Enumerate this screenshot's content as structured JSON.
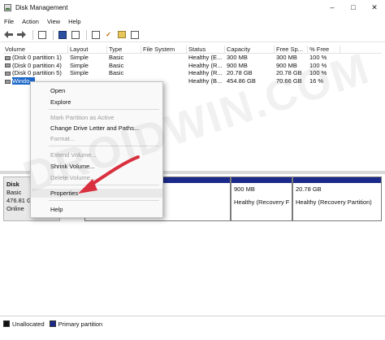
{
  "window": {
    "title": "Disk Management",
    "controls": [
      "–",
      "□",
      "✕"
    ]
  },
  "menu": [
    "File",
    "Action",
    "View",
    "Help"
  ],
  "toolbar_icons": [
    "back-arrow-icon",
    "forward-arrow-icon",
    "console-tree-icon",
    "help-icon",
    "properties-icon",
    "layout-icon",
    "check-icon",
    "folder-icon",
    "list-icon"
  ],
  "volume_table": {
    "headers": [
      "Volume",
      "Layout",
      "Type",
      "File System",
      "Status",
      "Capacity",
      "Free Sp...",
      "% Free"
    ],
    "rows": [
      [
        "(Disk 0 partition 1)",
        "Simple",
        "Basic",
        "",
        "Healthy (E...",
        "300 MB",
        "300 MB",
        "100 %"
      ],
      [
        "(Disk 0 partition 4)",
        "Simple",
        "Basic",
        "",
        "Healthy (R...",
        "900 MB",
        "900 MB",
        "100 %"
      ],
      [
        "(Disk 0 partition 5)",
        "Simple",
        "Basic",
        "",
        "Healthy (R...",
        "20.78 GB",
        "20.78 GB",
        "100 %"
      ],
      [
        "Windo...",
        "",
        "",
        "",
        "Healthy (B...",
        "454.86 GB",
        "70.66 GB",
        "16 %"
      ]
    ]
  },
  "disk": {
    "name": "Disk",
    "type": "Basic",
    "size": "476.81 GI",
    "status": "Online"
  },
  "partitions": [
    {
      "line1": "",
      "line2": "le, Crash Dump, Ba"
    },
    {
      "line1": "900 MB",
      "line2": "Healthy (Recovery F"
    },
    {
      "line1": "20.78 GB",
      "line2": "Healthy (Recovery Partition)"
    }
  ],
  "legend": [
    {
      "label": "Unallocated",
      "color": "#111111"
    },
    {
      "label": "Primary partition",
      "color": "#1b2a8a"
    }
  ],
  "context_menu": {
    "items": [
      {
        "label": "Open",
        "enabled": true
      },
      {
        "label": "Explore",
        "enabled": true
      },
      {
        "label": "Mark Partition as Active",
        "enabled": false
      },
      {
        "label": "Change Drive Letter and Paths...",
        "enabled": true
      },
      {
        "label": "Format...",
        "enabled": false
      },
      {
        "label": "Extend Volume...",
        "enabled": false
      },
      {
        "label": "Shrink Volume...",
        "enabled": true
      },
      {
        "label": "Delete Volume...",
        "enabled": false
      },
      {
        "label": "Properties",
        "enabled": true
      },
      {
        "label": "Help",
        "enabled": true
      }
    ]
  },
  "watermark": "DROIDWIN.COM",
  "colors": {
    "selection": "#1b67c9",
    "primary_partition": "#1b2a8a",
    "arrow": "#d9303f"
  }
}
